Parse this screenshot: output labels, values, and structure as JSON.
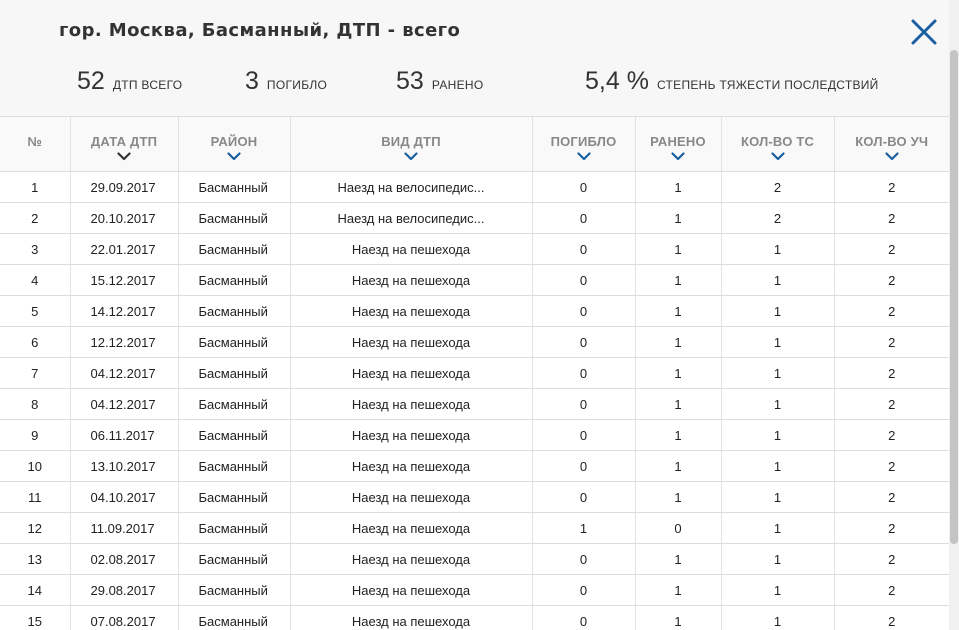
{
  "modal": {
    "title": "гор. Москва, Басманный, ДТП - всего",
    "close_icon": "close-icon",
    "accent_color": "#1a5fa0"
  },
  "stats": [
    {
      "value": "52",
      "label": "ДТП ВСЕГО"
    },
    {
      "value": "3",
      "label": "ПОГИБЛО"
    },
    {
      "value": "53",
      "label": "РАНЕНО"
    },
    {
      "value": "5,4 %",
      "label": "СТЕПЕНЬ ТЯЖЕСТИ ПОСЛЕДСТВИЙ"
    }
  ],
  "table": {
    "columns": [
      {
        "label": "№",
        "sort_icon": ""
      },
      {
        "label": "ДАТА ДТП",
        "sort_icon": "chevron-down-icon-active"
      },
      {
        "label": "РАЙОН",
        "sort_icon": "chevron-down-icon"
      },
      {
        "label": "ВИД ДТП",
        "sort_icon": "chevron-down-icon"
      },
      {
        "label": "ПОГИБЛО",
        "sort_icon": "chevron-down-icon"
      },
      {
        "label": "РАНЕНО",
        "sort_icon": "chevron-down-icon"
      },
      {
        "label": "КОЛ-ВО ТС",
        "sort_icon": "chevron-down-icon"
      },
      {
        "label": "КОЛ-ВО УЧ",
        "sort_icon": "chevron-down-icon"
      }
    ],
    "rows": [
      [
        "1",
        "29.09.2017",
        "Басманный",
        "Наезд на велосипедис...",
        "0",
        "1",
        "2",
        "2"
      ],
      [
        "2",
        "20.10.2017",
        "Басманный",
        "Наезд на велосипедис...",
        "0",
        "1",
        "2",
        "2"
      ],
      [
        "3",
        "22.01.2017",
        "Басманный",
        "Наезд на пешехода",
        "0",
        "1",
        "1",
        "2"
      ],
      [
        "4",
        "15.12.2017",
        "Басманный",
        "Наезд на пешехода",
        "0",
        "1",
        "1",
        "2"
      ],
      [
        "5",
        "14.12.2017",
        "Басманный",
        "Наезд на пешехода",
        "0",
        "1",
        "1",
        "2"
      ],
      [
        "6",
        "12.12.2017",
        "Басманный",
        "Наезд на пешехода",
        "0",
        "1",
        "1",
        "2"
      ],
      [
        "7",
        "04.12.2017",
        "Басманный",
        "Наезд на пешехода",
        "0",
        "1",
        "1",
        "2"
      ],
      [
        "8",
        "04.12.2017",
        "Басманный",
        "Наезд на пешехода",
        "0",
        "1",
        "1",
        "2"
      ],
      [
        "9",
        "06.11.2017",
        "Басманный",
        "Наезд на пешехода",
        "0",
        "1",
        "1",
        "2"
      ],
      [
        "10",
        "13.10.2017",
        "Басманный",
        "Наезд на пешехода",
        "0",
        "1",
        "1",
        "2"
      ],
      [
        "11",
        "04.10.2017",
        "Басманный",
        "Наезд на пешехода",
        "0",
        "1",
        "1",
        "2"
      ],
      [
        "12",
        "11.09.2017",
        "Басманный",
        "Наезд на пешехода",
        "1",
        "0",
        "1",
        "2"
      ],
      [
        "13",
        "02.08.2017",
        "Басманный",
        "Наезд на пешехода",
        "0",
        "1",
        "1",
        "2"
      ],
      [
        "14",
        "29.08.2017",
        "Басманный",
        "Наезд на пешехода",
        "0",
        "1",
        "1",
        "2"
      ],
      [
        "15",
        "07.08.2017",
        "Басманный",
        "Наезд на пешехода",
        "0",
        "1",
        "1",
        "2"
      ]
    ]
  }
}
